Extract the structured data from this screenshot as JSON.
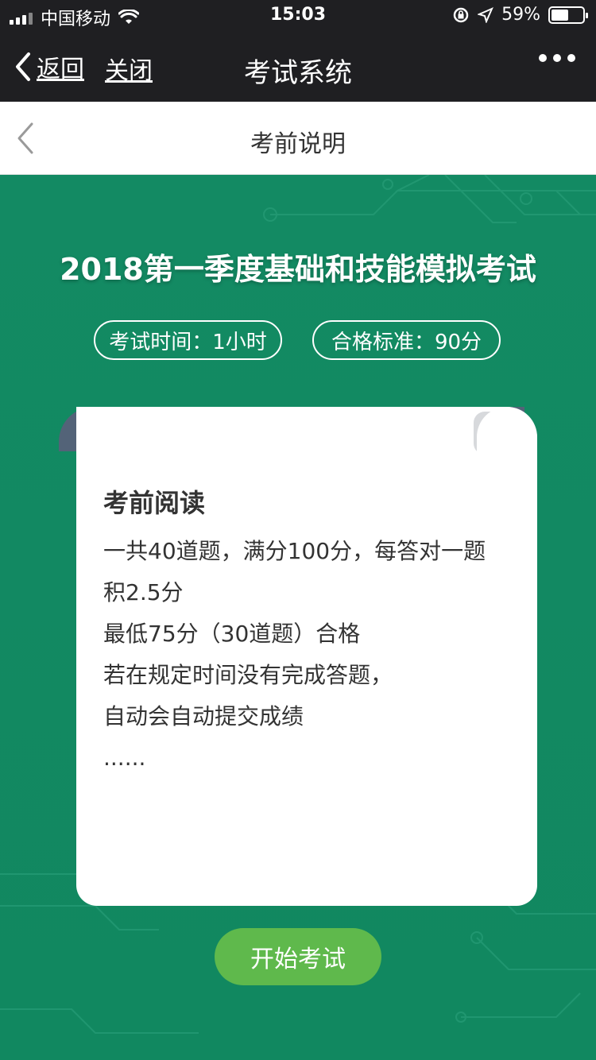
{
  "status_bar": {
    "carrier": "中国移动",
    "time": "15:03",
    "battery_percent": "59%",
    "battery_level": 0.59
  },
  "nav_bar": {
    "back_label": "返回",
    "close_label": "关闭",
    "title": "考试系统"
  },
  "page_header": {
    "title": "考前说明"
  },
  "exam": {
    "title": "2018第一季度基础和技能模拟考试",
    "duration": "考试时间：1小时",
    "pass_standard": "合格标准：90分"
  },
  "reading": {
    "heading": "考前阅读",
    "lines": [
      "一共40道题，满分100分，每答对一题",
      "积2.5分",
      "最低75分（30道题）合格",
      "若在规定时间没有完成答题，",
      "自动会自动提交成绩",
      "......"
    ]
  },
  "actions": {
    "start_label": "开始考试"
  },
  "colors": {
    "hero_green": "#138a63",
    "button_green": "#5fb94c",
    "scroll_slate": "#536378",
    "bar_dark": "#1f1f22"
  }
}
